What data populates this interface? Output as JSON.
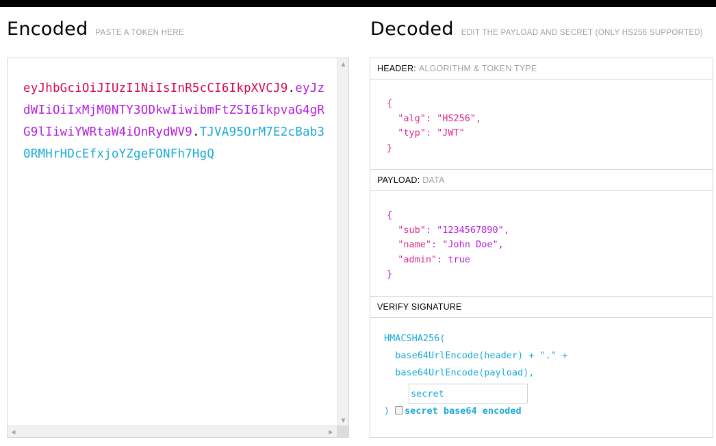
{
  "encoded": {
    "title": "Encoded",
    "subtitle": "PASTE A TOKEN HERE",
    "token": {
      "header": "eyJhbGciOiJIUzI1NiIsInR5cCI6IkpXVCJ9",
      "dot1": ".",
      "payload": "eyJzdWIiOiIxMjM0NTY3ODkwIiwibmFtZSI6IkpvaG4gRG9lIiwiYWRtaW4iOnRydWV9",
      "dot2": ".",
      "signature": "TJVA95OrM7E2cBab30RMHrHDcEfxjoYZgeFONFh7HgQ"
    },
    "scroll_up_icon": "▲",
    "scroll_down_icon": "▼",
    "scroll_left_icon": "◀",
    "scroll_right_icon": "▶"
  },
  "decoded": {
    "title": "Decoded",
    "subtitle": "EDIT THE PAYLOAD AND SECRET (ONLY HS256 SUPPORTED)",
    "header_section": {
      "label": "HEADER:",
      "sublabel": "ALGORITHM & TOKEN TYPE",
      "open": "{",
      "lines": [
        {
          "key": "\"alg\"",
          "rest": ": \"HS256\","
        },
        {
          "key": "\"typ\"",
          "rest": ": \"JWT\""
        }
      ],
      "close": "}"
    },
    "payload_section": {
      "label": "PAYLOAD:",
      "sublabel": "DATA",
      "open": "{",
      "lines": [
        {
          "key": "\"sub\"",
          "rest": ": \"1234567890\","
        },
        {
          "key": "\"name\"",
          "rest": ": \"John Doe\","
        },
        {
          "key": "\"admin\"",
          "rest": ": true"
        }
      ],
      "close": "}"
    },
    "signature_section": {
      "label": "VERIFY SIGNATURE",
      "line1": "HMACSHA256(",
      "line2": "  base64UrlEncode(header) + \".\" +",
      "line3": "  base64UrlEncode(payload),",
      "secret_value": "secret",
      "close_paren": ")",
      "checkbox_label": "secret base64 encoded",
      "checkbox_checked": false
    }
  },
  "colors": {
    "header": "#d6094e",
    "payload": "#b41ddc",
    "signature": "#19a9d8"
  }
}
